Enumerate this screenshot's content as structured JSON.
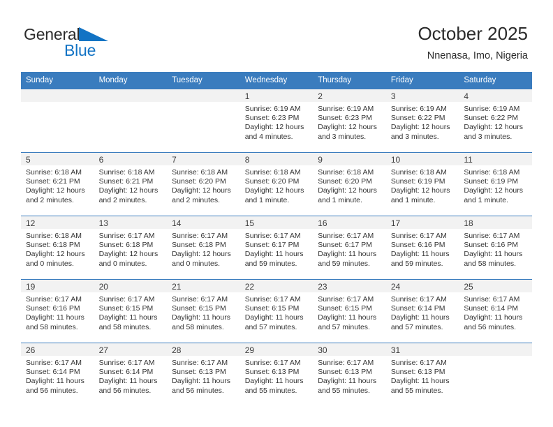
{
  "brand": {
    "name_part1": "General",
    "name_part2": "Blue",
    "triangle_color": "#1273c4"
  },
  "header": {
    "title": "October 2025",
    "subtitle": "Nnenasa, Imo, Nigeria"
  },
  "theme": {
    "header_blue": "#3a7cbe",
    "daynum_band": "#f2f2f2",
    "text": "#333333"
  },
  "weekday_headers": [
    "Sunday",
    "Monday",
    "Tuesday",
    "Wednesday",
    "Thursday",
    "Friday",
    "Saturday"
  ],
  "weeks": [
    [
      {
        "day": "",
        "empty": true,
        "sunrise": "",
        "sunset": "",
        "daylight_line1": "",
        "daylight_line2": ""
      },
      {
        "day": "",
        "empty": true,
        "sunrise": "",
        "sunset": "",
        "daylight_line1": "",
        "daylight_line2": ""
      },
      {
        "day": "",
        "empty": true,
        "sunrise": "",
        "sunset": "",
        "daylight_line1": "",
        "daylight_line2": ""
      },
      {
        "day": "1",
        "empty": false,
        "sunrise": "Sunrise: 6:19 AM",
        "sunset": "Sunset: 6:23 PM",
        "daylight_line1": "Daylight: 12 hours",
        "daylight_line2": "and 4 minutes."
      },
      {
        "day": "2",
        "empty": false,
        "sunrise": "Sunrise: 6:19 AM",
        "sunset": "Sunset: 6:23 PM",
        "daylight_line1": "Daylight: 12 hours",
        "daylight_line2": "and 3 minutes."
      },
      {
        "day": "3",
        "empty": false,
        "sunrise": "Sunrise: 6:19 AM",
        "sunset": "Sunset: 6:22 PM",
        "daylight_line1": "Daylight: 12 hours",
        "daylight_line2": "and 3 minutes."
      },
      {
        "day": "4",
        "empty": false,
        "sunrise": "Sunrise: 6:19 AM",
        "sunset": "Sunset: 6:22 PM",
        "daylight_line1": "Daylight: 12 hours",
        "daylight_line2": "and 3 minutes."
      }
    ],
    [
      {
        "day": "5",
        "empty": false,
        "sunrise": "Sunrise: 6:18 AM",
        "sunset": "Sunset: 6:21 PM",
        "daylight_line1": "Daylight: 12 hours",
        "daylight_line2": "and 2 minutes."
      },
      {
        "day": "6",
        "empty": false,
        "sunrise": "Sunrise: 6:18 AM",
        "sunset": "Sunset: 6:21 PM",
        "daylight_line1": "Daylight: 12 hours",
        "daylight_line2": "and 2 minutes."
      },
      {
        "day": "7",
        "empty": false,
        "sunrise": "Sunrise: 6:18 AM",
        "sunset": "Sunset: 6:20 PM",
        "daylight_line1": "Daylight: 12 hours",
        "daylight_line2": "and 2 minutes."
      },
      {
        "day": "8",
        "empty": false,
        "sunrise": "Sunrise: 6:18 AM",
        "sunset": "Sunset: 6:20 PM",
        "daylight_line1": "Daylight: 12 hours",
        "daylight_line2": "and 1 minute."
      },
      {
        "day": "9",
        "empty": false,
        "sunrise": "Sunrise: 6:18 AM",
        "sunset": "Sunset: 6:20 PM",
        "daylight_line1": "Daylight: 12 hours",
        "daylight_line2": "and 1 minute."
      },
      {
        "day": "10",
        "empty": false,
        "sunrise": "Sunrise: 6:18 AM",
        "sunset": "Sunset: 6:19 PM",
        "daylight_line1": "Daylight: 12 hours",
        "daylight_line2": "and 1 minute."
      },
      {
        "day": "11",
        "empty": false,
        "sunrise": "Sunrise: 6:18 AM",
        "sunset": "Sunset: 6:19 PM",
        "daylight_line1": "Daylight: 12 hours",
        "daylight_line2": "and 1 minute."
      }
    ],
    [
      {
        "day": "12",
        "empty": false,
        "sunrise": "Sunrise: 6:18 AM",
        "sunset": "Sunset: 6:18 PM",
        "daylight_line1": "Daylight: 12 hours",
        "daylight_line2": "and 0 minutes."
      },
      {
        "day": "13",
        "empty": false,
        "sunrise": "Sunrise: 6:17 AM",
        "sunset": "Sunset: 6:18 PM",
        "daylight_line1": "Daylight: 12 hours",
        "daylight_line2": "and 0 minutes."
      },
      {
        "day": "14",
        "empty": false,
        "sunrise": "Sunrise: 6:17 AM",
        "sunset": "Sunset: 6:18 PM",
        "daylight_line1": "Daylight: 12 hours",
        "daylight_line2": "and 0 minutes."
      },
      {
        "day": "15",
        "empty": false,
        "sunrise": "Sunrise: 6:17 AM",
        "sunset": "Sunset: 6:17 PM",
        "daylight_line1": "Daylight: 11 hours",
        "daylight_line2": "and 59 minutes."
      },
      {
        "day": "16",
        "empty": false,
        "sunrise": "Sunrise: 6:17 AM",
        "sunset": "Sunset: 6:17 PM",
        "daylight_line1": "Daylight: 11 hours",
        "daylight_line2": "and 59 minutes."
      },
      {
        "day": "17",
        "empty": false,
        "sunrise": "Sunrise: 6:17 AM",
        "sunset": "Sunset: 6:16 PM",
        "daylight_line1": "Daylight: 11 hours",
        "daylight_line2": "and 59 minutes."
      },
      {
        "day": "18",
        "empty": false,
        "sunrise": "Sunrise: 6:17 AM",
        "sunset": "Sunset: 6:16 PM",
        "daylight_line1": "Daylight: 11 hours",
        "daylight_line2": "and 58 minutes."
      }
    ],
    [
      {
        "day": "19",
        "empty": false,
        "sunrise": "Sunrise: 6:17 AM",
        "sunset": "Sunset: 6:16 PM",
        "daylight_line1": "Daylight: 11 hours",
        "daylight_line2": "and 58 minutes."
      },
      {
        "day": "20",
        "empty": false,
        "sunrise": "Sunrise: 6:17 AM",
        "sunset": "Sunset: 6:15 PM",
        "daylight_line1": "Daylight: 11 hours",
        "daylight_line2": "and 58 minutes."
      },
      {
        "day": "21",
        "empty": false,
        "sunrise": "Sunrise: 6:17 AM",
        "sunset": "Sunset: 6:15 PM",
        "daylight_line1": "Daylight: 11 hours",
        "daylight_line2": "and 58 minutes."
      },
      {
        "day": "22",
        "empty": false,
        "sunrise": "Sunrise: 6:17 AM",
        "sunset": "Sunset: 6:15 PM",
        "daylight_line1": "Daylight: 11 hours",
        "daylight_line2": "and 57 minutes."
      },
      {
        "day": "23",
        "empty": false,
        "sunrise": "Sunrise: 6:17 AM",
        "sunset": "Sunset: 6:15 PM",
        "daylight_line1": "Daylight: 11 hours",
        "daylight_line2": "and 57 minutes."
      },
      {
        "day": "24",
        "empty": false,
        "sunrise": "Sunrise: 6:17 AM",
        "sunset": "Sunset: 6:14 PM",
        "daylight_line1": "Daylight: 11 hours",
        "daylight_line2": "and 57 minutes."
      },
      {
        "day": "25",
        "empty": false,
        "sunrise": "Sunrise: 6:17 AM",
        "sunset": "Sunset: 6:14 PM",
        "daylight_line1": "Daylight: 11 hours",
        "daylight_line2": "and 56 minutes."
      }
    ],
    [
      {
        "day": "26",
        "empty": false,
        "sunrise": "Sunrise: 6:17 AM",
        "sunset": "Sunset: 6:14 PM",
        "daylight_line1": "Daylight: 11 hours",
        "daylight_line2": "and 56 minutes."
      },
      {
        "day": "27",
        "empty": false,
        "sunrise": "Sunrise: 6:17 AM",
        "sunset": "Sunset: 6:14 PM",
        "daylight_line1": "Daylight: 11 hours",
        "daylight_line2": "and 56 minutes."
      },
      {
        "day": "28",
        "empty": false,
        "sunrise": "Sunrise: 6:17 AM",
        "sunset": "Sunset: 6:13 PM",
        "daylight_line1": "Daylight: 11 hours",
        "daylight_line2": "and 56 minutes."
      },
      {
        "day": "29",
        "empty": false,
        "sunrise": "Sunrise: 6:17 AM",
        "sunset": "Sunset: 6:13 PM",
        "daylight_line1": "Daylight: 11 hours",
        "daylight_line2": "and 55 minutes."
      },
      {
        "day": "30",
        "empty": false,
        "sunrise": "Sunrise: 6:17 AM",
        "sunset": "Sunset: 6:13 PM",
        "daylight_line1": "Daylight: 11 hours",
        "daylight_line2": "and 55 minutes."
      },
      {
        "day": "31",
        "empty": false,
        "sunrise": "Sunrise: 6:17 AM",
        "sunset": "Sunset: 6:13 PM",
        "daylight_line1": "Daylight: 11 hours",
        "daylight_line2": "and 55 minutes."
      },
      {
        "day": "",
        "empty": true,
        "sunrise": "",
        "sunset": "",
        "daylight_line1": "",
        "daylight_line2": ""
      }
    ]
  ]
}
